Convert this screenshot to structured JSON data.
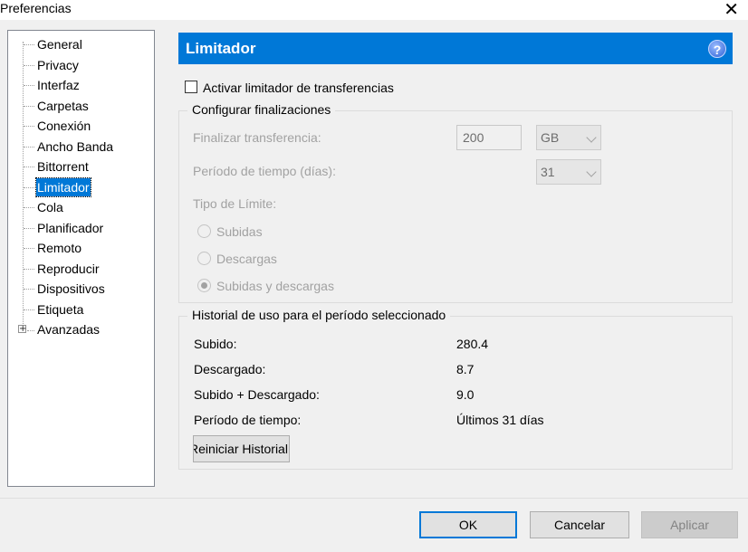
{
  "window": {
    "title": "Preferencias",
    "close_glyph": "✕"
  },
  "tree": {
    "items": [
      {
        "label": "General"
      },
      {
        "label": "Privacy"
      },
      {
        "label": "Interfaz"
      },
      {
        "label": "Carpetas"
      },
      {
        "label": "Conexión"
      },
      {
        "label": "Ancho Banda"
      },
      {
        "label": "Bittorrent"
      },
      {
        "label": "Limitador",
        "selected": true
      },
      {
        "label": "Cola"
      },
      {
        "label": "Planificador"
      },
      {
        "label": "Remoto"
      },
      {
        "label": "Reproducir"
      },
      {
        "label": "Dispositivos"
      },
      {
        "label": "Etiqueta"
      },
      {
        "label": "Avanzadas",
        "expandable": true
      }
    ],
    "expander_glyph": "+"
  },
  "panel": {
    "header": "Limitador",
    "help_glyph": "?",
    "accent_color": "#0078d7",
    "enable_checkbox": {
      "label": "Activar limitador de transferencias",
      "checked": false
    },
    "config": {
      "title": "Configurar finalizaciones",
      "finalize_label": "Finalizar transferencia:",
      "finalize_value": "200",
      "finalize_unit": "GB",
      "period_label": "Período de tiempo (días):",
      "period_value": "31",
      "limit_type_label": "Tipo de Límite:",
      "radios": [
        {
          "label": "Subidas",
          "selected": false
        },
        {
          "label": "Descargas",
          "selected": false
        },
        {
          "label": "Subidas y descargas",
          "selected": true
        }
      ]
    },
    "history": {
      "title": "Historial de uso para el período seleccionado",
      "rows": [
        {
          "label": "Subido:",
          "value": "280.4"
        },
        {
          "label": "Descargado:",
          "value": "8.7"
        },
        {
          "label": "Subido + Descargado:",
          "value": "9.0"
        },
        {
          "label": "Período de tiempo:",
          "value": "Últimos 31 días"
        }
      ],
      "reset_button": "Reiniciar Historial"
    }
  },
  "footer": {
    "ok": "OK",
    "cancel": "Cancelar",
    "apply": "Aplicar"
  }
}
